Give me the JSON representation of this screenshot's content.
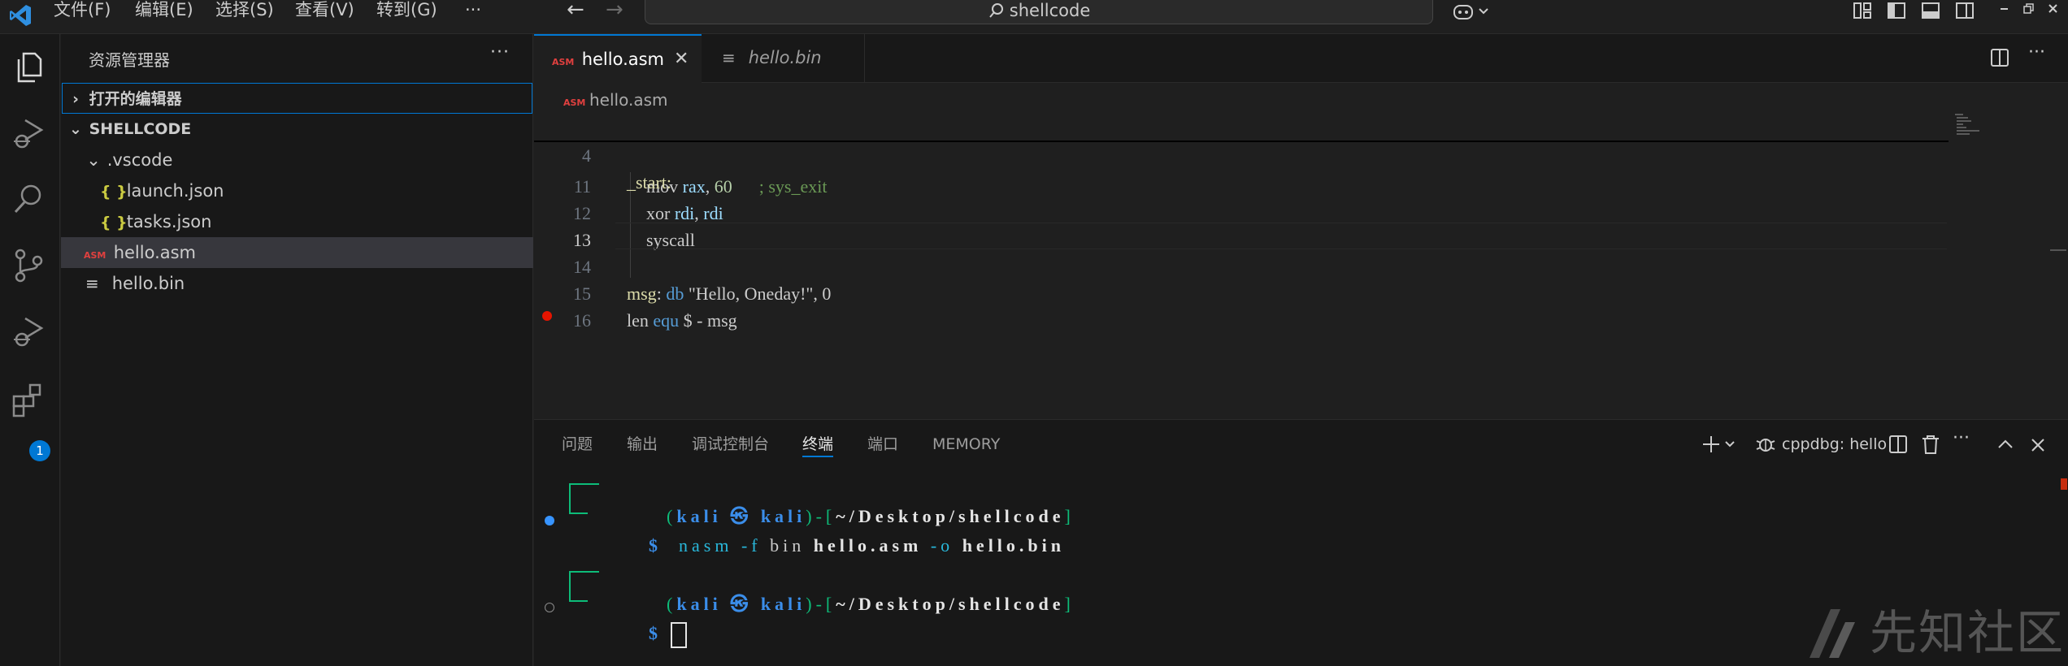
{
  "titlebar": {
    "menu": [
      "文件(F)",
      "编辑(E)",
      "选择(S)",
      "查看(V)",
      "转到(G)",
      "···"
    ],
    "search_text": "shellcode"
  },
  "activitybar": {
    "icons": [
      "explorer-icon",
      "run-debug-icon",
      "search-icon",
      "source-control-icon",
      "run-debug-icon",
      "extensions-icon"
    ],
    "extensions_badge": "1"
  },
  "sidebar": {
    "title": "资源管理器",
    "more": "···",
    "open_editors": "打开的编辑器",
    "folder": "SHELLCODE",
    "items": [
      {
        "label": ".vscode",
        "type": "folder"
      },
      {
        "label": "launch.json",
        "type": "json",
        "icon_text": "{ }"
      },
      {
        "label": "tasks.json",
        "type": "json",
        "icon_text": "{ }"
      },
      {
        "label": "hello.asm",
        "type": "asm",
        "icon_text": "ASM"
      },
      {
        "label": "hello.bin",
        "type": "bin",
        "icon_text": "≡"
      }
    ]
  },
  "editor": {
    "tabs": [
      {
        "label": "hello.asm",
        "active": true,
        "icon_text": "ASM"
      },
      {
        "label": "hello.bin",
        "active": false,
        "icon_text": "≡"
      }
    ],
    "breadcrumb": "hello.asm",
    "sticky": {
      "line": "4",
      "text": "_start:"
    },
    "lines": [
      {
        "n": "11",
        "indent": "  ",
        "parts": [
          [
            "mov ",
            "plain"
          ],
          [
            "rax",
            "reg"
          ],
          [
            ", ",
            "plain"
          ],
          [
            "60",
            "num"
          ],
          [
            "      ; sys_exit",
            "cmt"
          ]
        ]
      },
      {
        "n": "12",
        "indent": "  ",
        "parts": [
          [
            "xor ",
            "plain"
          ],
          [
            "rdi",
            "reg"
          ],
          [
            ", ",
            "plain"
          ],
          [
            "rdi",
            "reg"
          ]
        ]
      },
      {
        "n": "13",
        "indent": "  ",
        "parts": [
          [
            "syscall",
            "plain"
          ]
        ]
      },
      {
        "n": "14",
        "indent": "",
        "parts": []
      },
      {
        "n": "15",
        "indent": "",
        "parts": [
          [
            "msg",
            "lbl"
          ],
          [
            ": ",
            "plain"
          ],
          [
            "db",
            "kw"
          ],
          [
            " \"Hello, Oneday!\", 0",
            "plain"
          ]
        ]
      },
      {
        "n": "16",
        "indent": "",
        "parts": [
          [
            "len ",
            "plain"
          ],
          [
            "equ",
            "kw"
          ],
          [
            " $ - msg",
            "plain"
          ]
        ]
      }
    ]
  },
  "panel": {
    "tabs": [
      "问题",
      "输出",
      "调试控制台",
      "终端",
      "端口",
      "MEMORY"
    ],
    "active_tab": "终端",
    "terminal_name": "cppdbg: hello",
    "terminal": {
      "prompt_user": "kali",
      "prompt_symbol": "㉿",
      "prompt_host": "kali",
      "prompt_path": "~/Desktop/shellcode",
      "command": {
        "cmd": "nasm",
        "flag1": "-f",
        "arg1": "bin",
        "arg2": "hello.asm",
        "flag2": "-o",
        "arg3": "hello.bin"
      },
      "dollar": "$"
    }
  },
  "watermark": "先知社区",
  "colors": {
    "accent": "#0078d4",
    "breakpoint": "#e51400",
    "terminal_green": "#0dbc79",
    "terminal_blue": "#3b8eea"
  }
}
